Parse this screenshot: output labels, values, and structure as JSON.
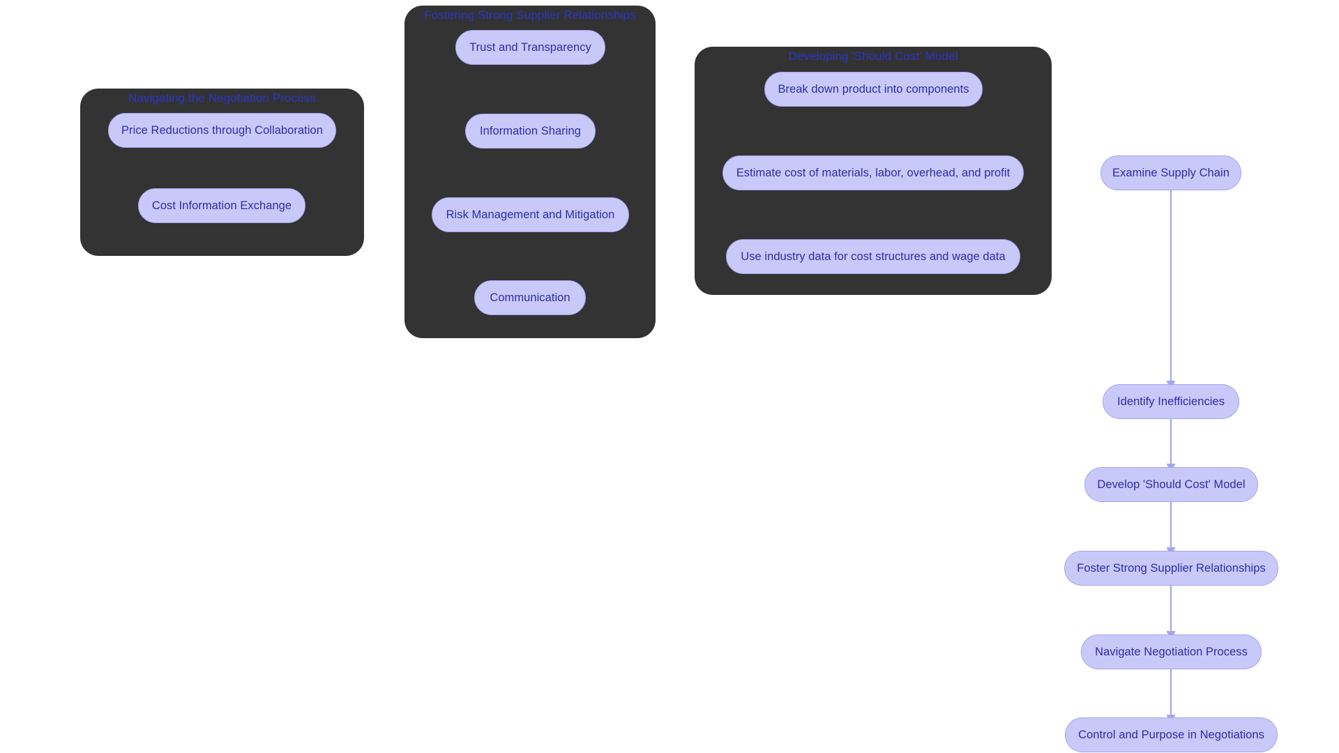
{
  "diagram": {
    "type": "flowchart",
    "title_color": "#2b35c4",
    "node_fill": "#c9c9f9",
    "node_stroke": "#a3a3ef",
    "node_text_color": "#2c2ca8",
    "cluster_fill": "#333333",
    "edge_color": "#a5a5ee",
    "background": "#ffffff"
  },
  "clusters": [
    {
      "id": "negotiation",
      "title": "Navigating the Negotiation Process",
      "nodes": [
        {
          "id": "price_reductions",
          "label": "Price Reductions through Collaboration"
        },
        {
          "id": "cost_info_exchange",
          "label": "Cost Information Exchange"
        }
      ],
      "edges": [
        {
          "from": "price_reductions",
          "to": "cost_info_exchange"
        }
      ]
    },
    {
      "id": "supplier_relationships",
      "title": "Fostering Strong Supplier Relationships",
      "nodes": [
        {
          "id": "trust_transparency",
          "label": "Trust and Transparency"
        },
        {
          "id": "information_sharing",
          "label": "Information Sharing"
        },
        {
          "id": "risk_management",
          "label": "Risk Management and Mitigation"
        },
        {
          "id": "communication",
          "label": "Communication"
        }
      ],
      "edges": [
        {
          "from": "trust_transparency",
          "to": "information_sharing"
        },
        {
          "from": "information_sharing",
          "to": "risk_management"
        },
        {
          "from": "risk_management",
          "to": "communication"
        }
      ]
    },
    {
      "id": "should_cost_model",
      "title": "Developing 'Should Cost' Model",
      "nodes": [
        {
          "id": "break_down",
          "label": "Break down product into components"
        },
        {
          "id": "estimate_cost",
          "label": "Estimate cost of materials, labor, overhead, and profit"
        },
        {
          "id": "industry_data",
          "label": "Use industry data for cost structures and wage data"
        }
      ],
      "edges": [
        {
          "from": "break_down",
          "to": "estimate_cost"
        },
        {
          "from": "estimate_cost",
          "to": "industry_data"
        }
      ]
    }
  ],
  "main_flow": {
    "nodes": [
      {
        "id": "examine_supply_chain",
        "label": "Examine Supply Chain"
      },
      {
        "id": "identify_inefficiencies",
        "label": "Identify Inefficiencies"
      },
      {
        "id": "develop_should_cost",
        "label": "Develop 'Should Cost' Model"
      },
      {
        "id": "foster_supplier",
        "label": "Foster Strong Supplier Relationships"
      },
      {
        "id": "navigate_negotiation",
        "label": "Navigate Negotiation Process"
      },
      {
        "id": "control_purpose",
        "label": "Control and Purpose in Negotiations"
      }
    ],
    "edges": [
      {
        "from": "examine_supply_chain",
        "to": "identify_inefficiencies"
      },
      {
        "from": "identify_inefficiencies",
        "to": "develop_should_cost"
      },
      {
        "from": "develop_should_cost",
        "to": "foster_supplier"
      },
      {
        "from": "foster_supplier",
        "to": "navigate_negotiation"
      },
      {
        "from": "navigate_negotiation",
        "to": "control_purpose"
      }
    ]
  }
}
